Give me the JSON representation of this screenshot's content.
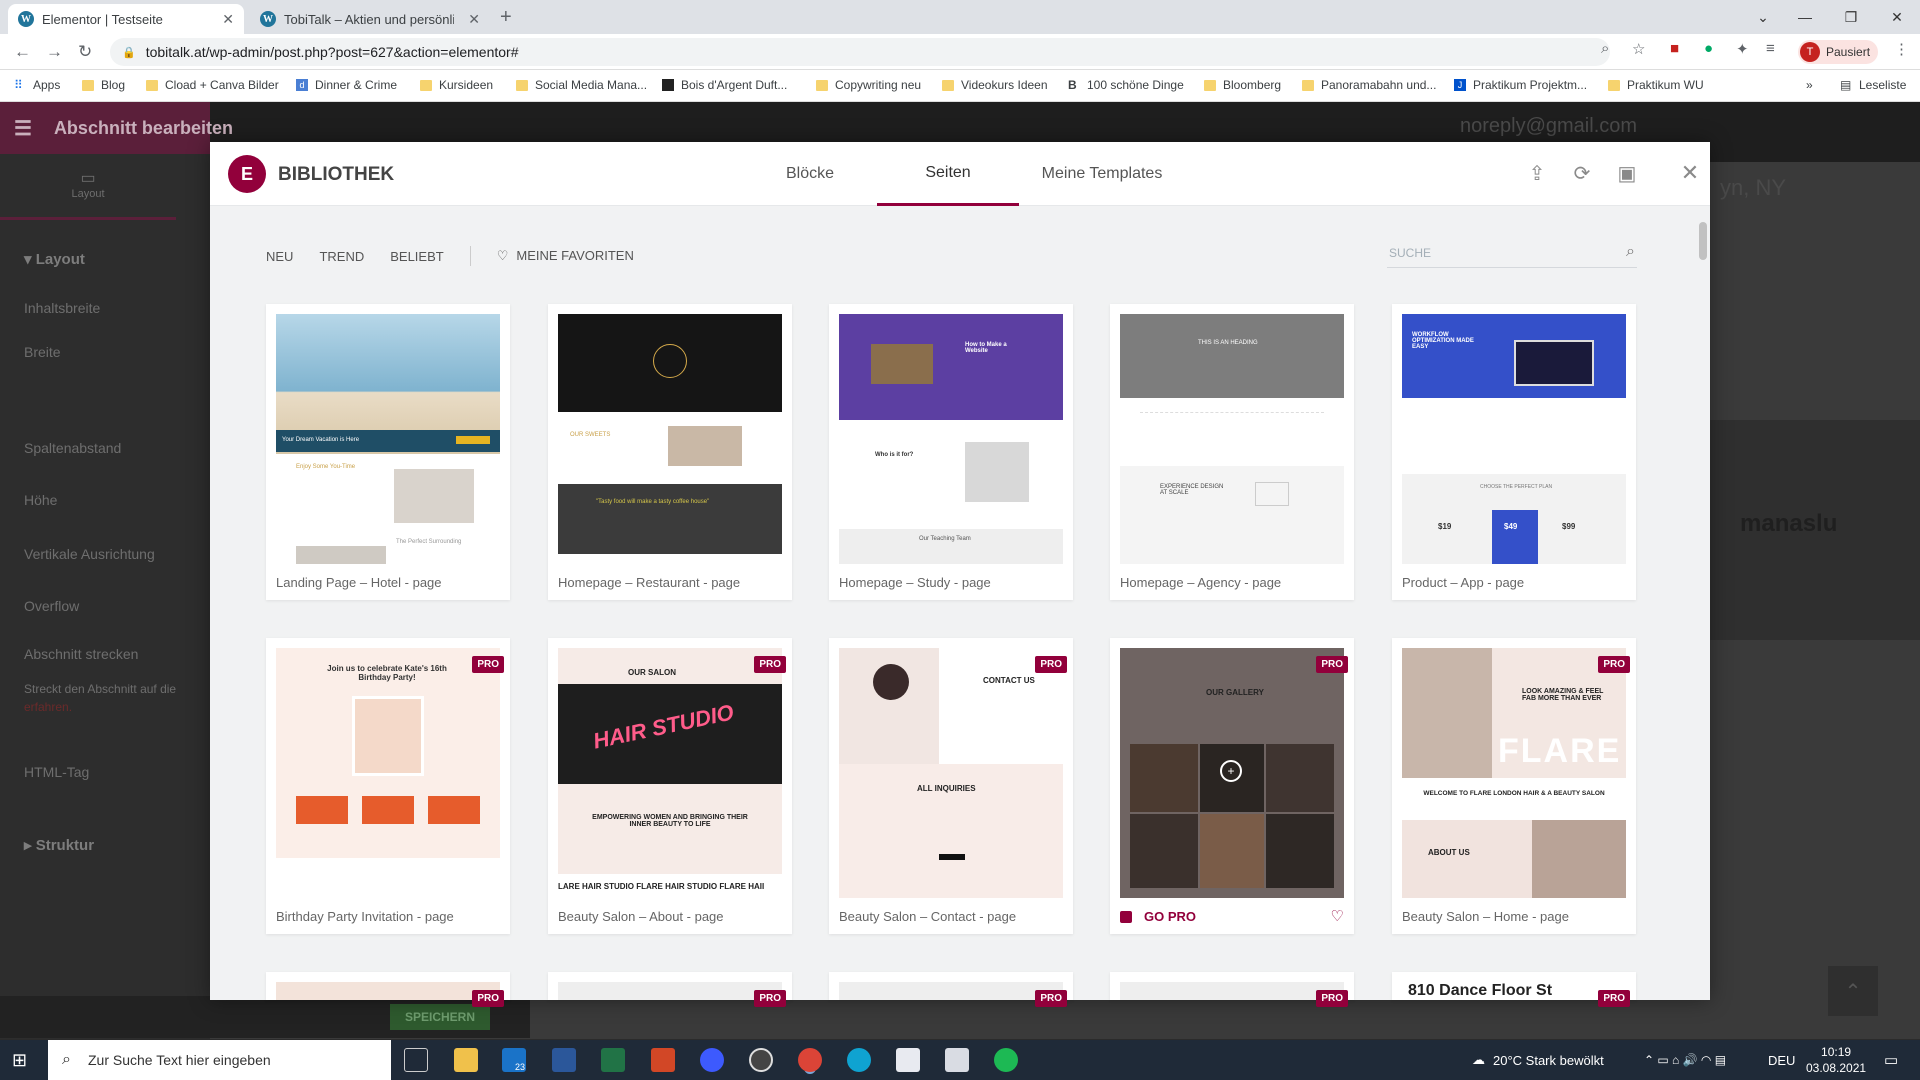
{
  "browser": {
    "tabs": [
      {
        "label": "Elementor | Testseite",
        "active": true
      },
      {
        "label": "TobiTalk – Aktien und persönlich",
        "active": false
      }
    ],
    "url": "tobitalk.at/wp-admin/post.php?post=627&action=elementor#",
    "profile_label": "Pausiert",
    "profile_initial": "T",
    "bookmarks": [
      "Apps",
      "Blog",
      "Cload + Canva Bilder",
      "Dinner & Crime",
      "Kursideen",
      "Social Media Mana...",
      "Bois d'Argent Duft...",
      "Copywriting neu",
      "Videokurs Ideen",
      "100 schöne Dinge",
      "Bloomberg",
      "Panoramabahn und...",
      "Praktikum Projektm...",
      "Praktikum WU"
    ],
    "reading_list": "Leseliste",
    "more": "»"
  },
  "editor": {
    "header_title": "Abschnitt bearbeiten",
    "tab_layout": "Layout",
    "section_layout": "Layout",
    "items": [
      "Inhaltsbreite",
      "Breite",
      "Spaltenabstand",
      "Höhe",
      "Vertikale Ausrichtung",
      "Overflow",
      "Abschnitt strecken",
      "Streckt den Abschnitt auf die",
      "erfahren.",
      "HTML-Tag"
    ],
    "section_struktur": "Struktur",
    "save_label": "SPEICHERN"
  },
  "site_bg": {
    "email": "noreply@gmail.com",
    "city": "yn, NY",
    "brand": "manaslu"
  },
  "modal": {
    "title": "BIBLIOTHEK",
    "logo": "E",
    "tabs": [
      "Blöcke",
      "Seiten",
      "Meine Templates"
    ],
    "active_tab": "Seiten",
    "filters": [
      "NEU",
      "TREND",
      "BELIEBT"
    ],
    "favorites": "MEINE FAVORITEN",
    "search_placeholder": "SUCHE",
    "pro_badge": "PRO",
    "go_pro": "GO PRO",
    "cards": [
      {
        "label": "Landing Page – Hotel - page",
        "pro": false
      },
      {
        "label": "Homepage – Restaurant - page",
        "pro": false
      },
      {
        "label": "Homepage – Study - page",
        "pro": false
      },
      {
        "label": "Homepage – Agency - page",
        "pro": false
      },
      {
        "label": "Product – App - page",
        "pro": false
      },
      {
        "label": "Birthday Party Invitation - page",
        "pro": true
      },
      {
        "label": "Beauty Salon – About - page",
        "pro": true
      },
      {
        "label": "Beauty Salon – Contact - page",
        "pro": true
      },
      {
        "label": "GO PRO",
        "pro": true
      },
      {
        "label": "Beauty Salon – Home - page",
        "pro": true
      }
    ],
    "thumb_text": {
      "hotel_banner": "Your Dream Vacation is Here",
      "hotel_sub": "Enjoy Some You-Time",
      "hotel_sub2": "The Perfect Surrounding",
      "study_title": "How to Make a Website",
      "study_sub": "Who is it for?",
      "study_team": "Our Teaching Team",
      "agency_heading": "THIS IS AN HEADING",
      "agency_exp": "EXPERIENCE DESIGN AT SCALE",
      "app_title": "WORKFLOW OPTIMIZATION MADE EASY",
      "app_plan": "CHOOSE THE PERFECT PLAN",
      "app_prices": [
        "$19",
        "$49",
        "$99"
      ],
      "restaurant_sweets": "OUR SWEETS",
      "restaurant_quote": "\"Tasty food will make a tasty coffee house\"",
      "birthday_title": "Join us to celebrate Kate's 16th Birthday Party!",
      "salon_title": "OUR SALON",
      "salon_neon": "HAIR STUDIO",
      "salon_tagline": "EMPOWERING WOMEN AND BRINGING THEIR INNER BEAUTY TO LIFE",
      "salon_marquee": "LARE HAIR STUDIO FLARE HAIR STUDIO FLARE HAII",
      "contact_title": "CONTACT US",
      "contact_inq": "ALL INQUIRIES",
      "gallery_title": "OUR GALLERY",
      "home_title": "LOOK AMAZING & FEEL FAB MORE THAN EVER",
      "home_flare": "FLARE",
      "home_welcome": "WELCOME TO FLARE LONDON HAIR & A BEAUTY SALON",
      "home_about": "ABOUT US",
      "dance": "810 Dance Floor St"
    }
  },
  "taskbar": {
    "search_placeholder": "Zur Suche Text hier eingeben",
    "weather": "20°C  Stark bewölkt",
    "lang": "DEU",
    "time": "10:19",
    "date": "03.08.2021",
    "mail_badge": "23"
  },
  "colors": {
    "elementor_brand": "#92003b",
    "chrome_tabbar": "#dee1e6",
    "taskbar": "#1f2a38"
  }
}
